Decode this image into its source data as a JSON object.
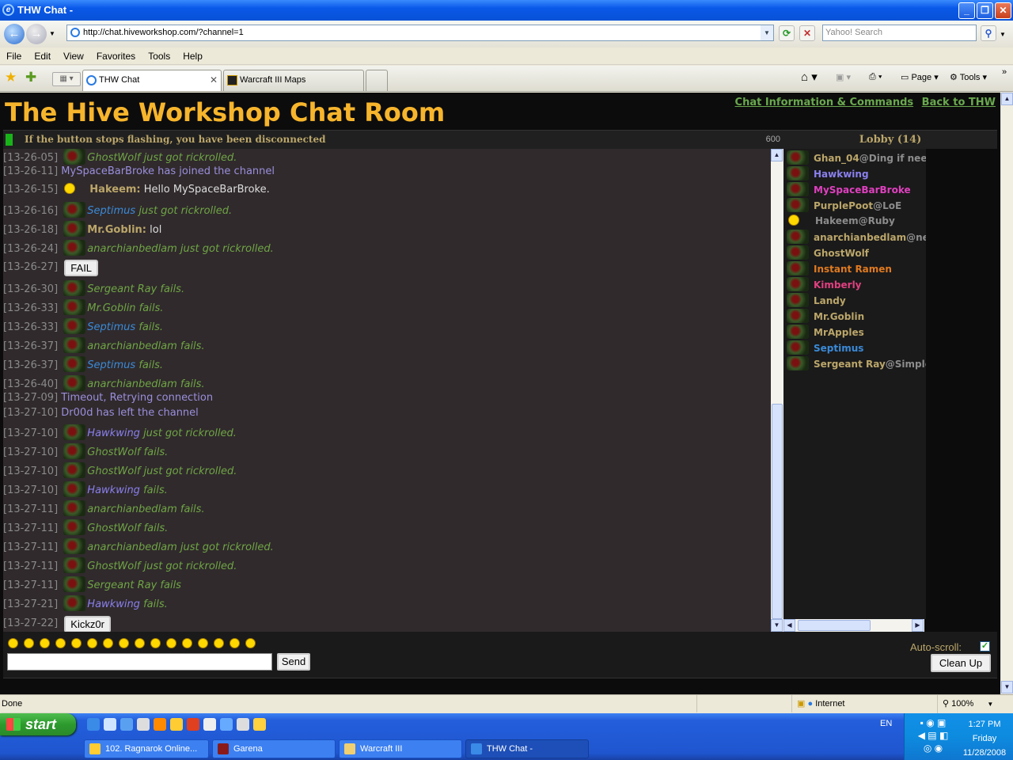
{
  "window": {
    "title": "THW Chat -"
  },
  "address": {
    "url": "http://chat.hiveworkshop.com/?channel=1",
    "search_placeholder": "Yahoo! Search"
  },
  "menu": [
    "File",
    "Edit",
    "View",
    "Favorites",
    "Tools",
    "Help"
  ],
  "tabs": [
    {
      "label": "THW Chat",
      "active": true
    },
    {
      "label": "Warcraft III Maps",
      "active": false
    }
  ],
  "command_bar": {
    "page": "Page",
    "tools": "Tools"
  },
  "page": {
    "title": "The Hive Workshop Chat Room",
    "links": [
      "Chat Information & Commands",
      "Back to THW"
    ],
    "status_message": "If the button stops flashing, you have been disconnected",
    "status_count": "600",
    "lobby_header": "Lobby (14)"
  },
  "chat": [
    {
      "ts": "[13-26-05]",
      "type": "action",
      "avatar": "avatar",
      "name": "GhostWolf",
      "text": " just got rickrolled.",
      "name_color": "#6fa545"
    },
    {
      "ts": "[13-26-11]",
      "type": "system",
      "text": "MySpaceBarBroke has joined the channel"
    },
    {
      "ts": "[13-26-15]",
      "type": "say",
      "avatar": "smiley",
      "name": "Hakeem:",
      "text": " Hello MySpaceBarBroke."
    },
    {
      "ts": "[13-26-16]",
      "type": "action",
      "avatar": "avatar",
      "name": "Septimus",
      "text": " just got rickrolled.",
      "name_color": "#3a8ad8"
    },
    {
      "ts": "[13-26-18]",
      "type": "say",
      "avatar": "avatar",
      "name": "Mr.Goblin:",
      "text": " lol"
    },
    {
      "ts": "[13-26-24]",
      "type": "action",
      "avatar": "avatar",
      "name": "anarchianbedlam",
      "text": " just got rickrolled.",
      "name_color": "#6fa545"
    },
    {
      "ts": "[13-26-27]",
      "type": "button",
      "text": "FAIL"
    },
    {
      "ts": "[13-26-30]",
      "type": "action",
      "avatar": "avatar",
      "name": "Sergeant Ray",
      "text": " fails.",
      "name_color": "#6fa545"
    },
    {
      "ts": "[13-26-33]",
      "type": "action",
      "avatar": "avatar",
      "name": "Mr.Goblin",
      "text": " fails.",
      "name_color": "#6fa545"
    },
    {
      "ts": "[13-26-33]",
      "type": "action",
      "avatar": "avatar",
      "name": "Septimus",
      "text": " fails.",
      "name_color": "#3a8ad8"
    },
    {
      "ts": "[13-26-37]",
      "type": "action",
      "avatar": "avatar",
      "name": "anarchianbedlam",
      "text": " fails.",
      "name_color": "#6fa545"
    },
    {
      "ts": "[13-26-37]",
      "type": "action",
      "avatar": "avatar",
      "name": "Septimus",
      "text": " fails.",
      "name_color": "#3a8ad8"
    },
    {
      "ts": "[13-26-40]",
      "type": "action",
      "avatar": "avatar",
      "name": "anarchianbedlam",
      "text": " fails.",
      "name_color": "#6fa545"
    },
    {
      "ts": "[13-27-09]",
      "type": "system",
      "text": "Timeout, Retrying connection"
    },
    {
      "ts": "[13-27-10]",
      "type": "system",
      "text": "Dr00d has left the channel"
    },
    {
      "ts": "[13-27-10]",
      "type": "action",
      "avatar": "avatar",
      "name": "Hawkwing",
      "text": " just got rickrolled.",
      "name_color": "#8a80ee"
    },
    {
      "ts": "[13-27-10]",
      "type": "action",
      "avatar": "avatar",
      "name": "GhostWolf",
      "text": " fails.",
      "name_color": "#6fa545"
    },
    {
      "ts": "[13-27-10]",
      "type": "action",
      "avatar": "avatar",
      "name": "GhostWolf",
      "text": " just got rickrolled.",
      "name_color": "#6fa545"
    },
    {
      "ts": "[13-27-10]",
      "type": "action",
      "avatar": "avatar",
      "name": "Hawkwing",
      "text": " fails.",
      "name_color": "#8a80ee"
    },
    {
      "ts": "[13-27-11]",
      "type": "action",
      "avatar": "avatar",
      "name": "anarchianbedlam",
      "text": " fails.",
      "name_color": "#6fa545"
    },
    {
      "ts": "[13-27-11]",
      "type": "action",
      "avatar": "avatar",
      "name": "GhostWolf",
      "text": " fails.",
      "name_color": "#6fa545"
    },
    {
      "ts": "[13-27-11]",
      "type": "action",
      "avatar": "avatar",
      "name": "anarchianbedlam",
      "text": " just got rickrolled.",
      "name_color": "#6fa545"
    },
    {
      "ts": "[13-27-11]",
      "type": "action",
      "avatar": "avatar",
      "name": "GhostWolf",
      "text": " just got rickrolled.",
      "name_color": "#6fa545"
    },
    {
      "ts": "[13-27-11]",
      "type": "action",
      "avatar": "avatar",
      "name": "Sergeant Ray",
      "text": " fails",
      "name_color": "#6fa545"
    },
    {
      "ts": "[13-27-21]",
      "type": "action",
      "avatar": "avatar",
      "name": "Hawkwing",
      "text": " fails.",
      "name_color": "#8a80ee"
    },
    {
      "ts": "[13-27-22]",
      "type": "button",
      "text": "Kickz0r"
    }
  ],
  "lobby": [
    {
      "name": "Ghan_04",
      "ext": "@Ding if nee",
      "color": "#bba66a",
      "avatar": "avatar"
    },
    {
      "name": "Hawkwing",
      "ext": "",
      "color": "#8a80ee",
      "avatar": "avatar"
    },
    {
      "name": "MySpaceBarBroke",
      "ext": "",
      "color": "#e040c0",
      "avatar": "avatar"
    },
    {
      "name": "PurplePoot",
      "ext": "@LoE",
      "color": "#bba66a",
      "avatar": "avatar"
    },
    {
      "name": "Hakeem",
      "ext": "@Ruby",
      "color": "#8c8c8c",
      "avatar": "smiley"
    },
    {
      "name": "anarchianbedlam",
      "ext": "@ne",
      "color": "#bba66a",
      "avatar": "avatar"
    },
    {
      "name": "GhostWolf",
      "ext": "",
      "color": "#bba66a",
      "avatar": "avatar"
    },
    {
      "name": "Instant Ramen",
      "ext": "",
      "color": "#e07a20",
      "avatar": "avatar"
    },
    {
      "name": "Kimberly",
      "ext": "",
      "color": "#e04080",
      "avatar": "avatar"
    },
    {
      "name": "Landy",
      "ext": "",
      "color": "#bba66a",
      "avatar": "avatar"
    },
    {
      "name": "Mr.Goblin",
      "ext": "",
      "color": "#bba66a",
      "avatar": "avatar"
    },
    {
      "name": "MrApples",
      "ext": "",
      "color": "#bba66a",
      "avatar": "avatar"
    },
    {
      "name": "Septimus",
      "ext": "",
      "color": "#3a8ad8",
      "avatar": "avatar"
    },
    {
      "name": "Sergeant Ray",
      "ext": "@Simple",
      "color": "#bba66a",
      "avatar": "avatar"
    }
  ],
  "input": {
    "send_label": "Send",
    "autoscroll_label": "Auto-scroll:",
    "autoscroll_checked": true,
    "cleanup_label": "Clean Up",
    "smiley_count": 16
  },
  "statusbar": {
    "left": "Done",
    "zone": "Internet",
    "zoom": "100%"
  },
  "taskbar": {
    "start_label": "start",
    "tasks": [
      {
        "label": "102. Ragnarok Online...",
        "active": false
      },
      {
        "label": "Garena",
        "active": false
      },
      {
        "label": "Warcraft III",
        "active": false
      },
      {
        "label": "THW Chat -",
        "active": true
      }
    ],
    "lang": "EN",
    "clock": {
      "time": "1:27 PM",
      "day": "Friday",
      "date": "11/28/2008"
    }
  }
}
